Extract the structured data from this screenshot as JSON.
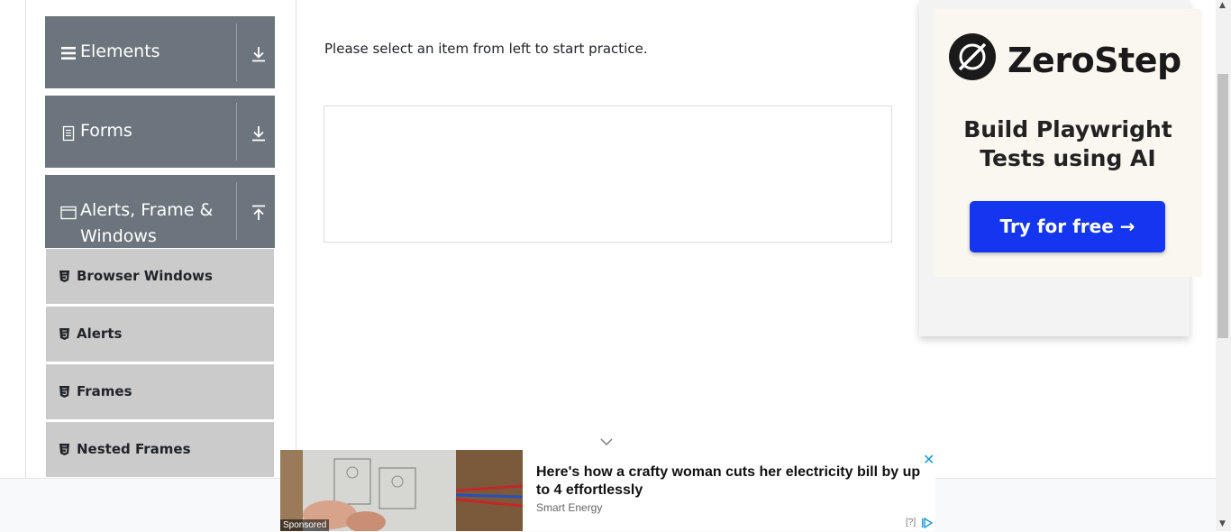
{
  "sidebar": {
    "groups": [
      {
        "title": "Elements",
        "icon": "hamburger-icon",
        "state_icon": "download-arrow-icon"
      },
      {
        "title": "Forms",
        "icon": "document-icon",
        "state_icon": "download-arrow-icon"
      },
      {
        "title_line1": "Alerts, Frame &",
        "title_line2": "Windows",
        "icon": "window-icon",
        "state_icon": "upload-arrow-icon"
      }
    ],
    "items": [
      {
        "label": "Browser Windows",
        "icon": "html5-icon"
      },
      {
        "label": "Alerts",
        "icon": "html5-icon"
      },
      {
        "label": "Frames",
        "icon": "html5-icon"
      },
      {
        "label": "Nested Frames",
        "icon": "html5-icon"
      }
    ]
  },
  "main": {
    "intro": "Please select an item from left to start practice."
  },
  "side_ad": {
    "brand": "ZeroStep",
    "headline_line1": "Build Playwright",
    "headline_line2": "Tests using AI",
    "cta": "Try for free →",
    "colors": {
      "cta": "#1436f0",
      "background": "#faf6f0"
    }
  },
  "bottom_ad": {
    "badge": "Sponsored",
    "title": "Here's how a crafty woman cuts her electricity bill by up to 4 effortlessly",
    "source": "Smart Energy",
    "close": "✕",
    "info": "[?]"
  }
}
